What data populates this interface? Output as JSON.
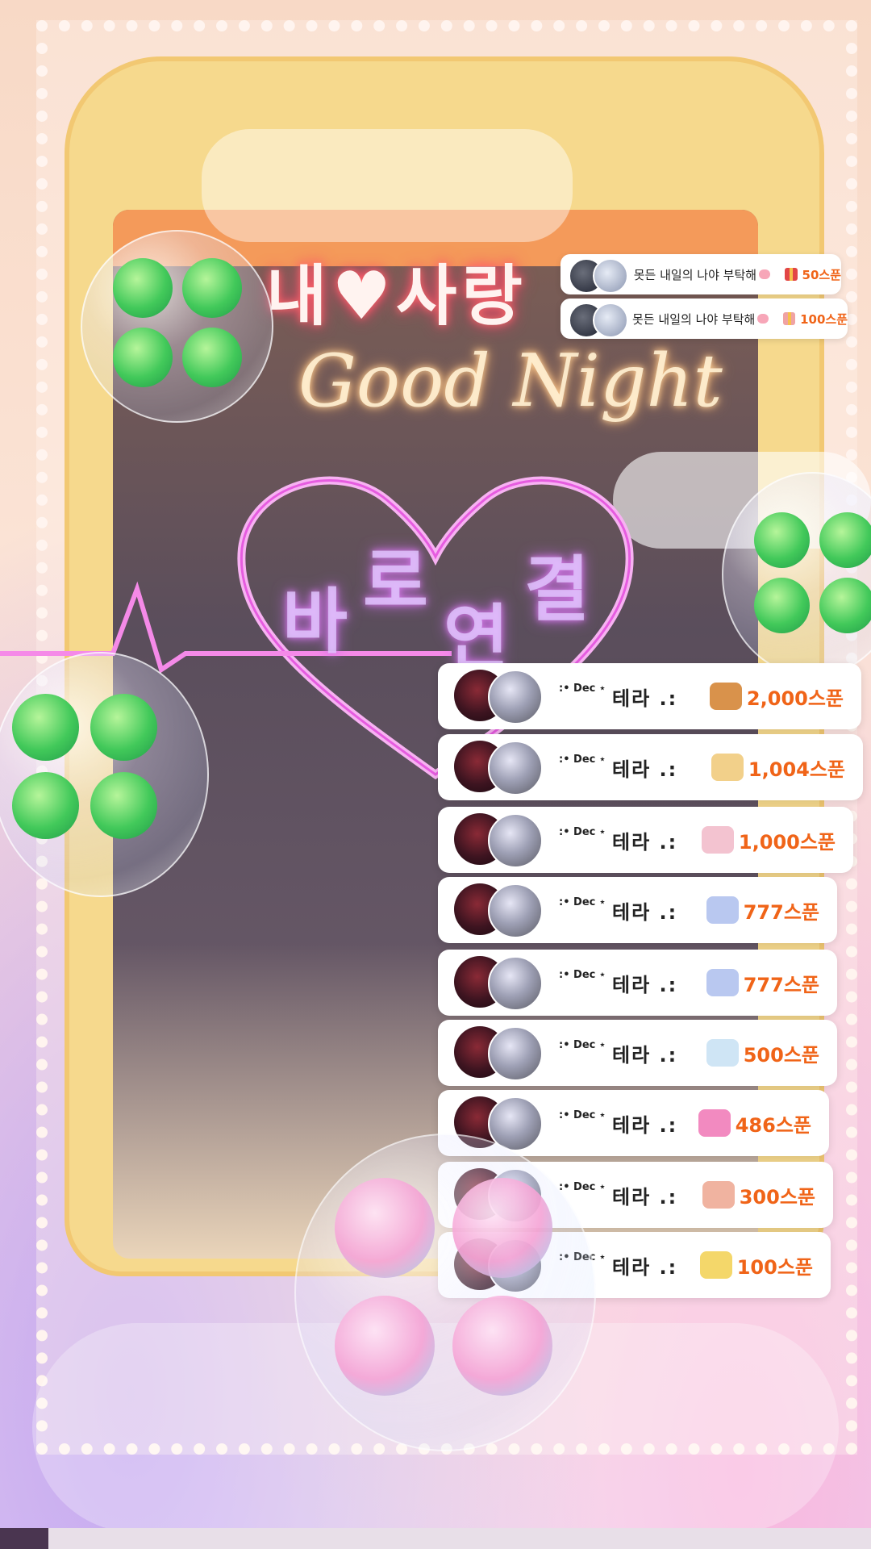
{
  "overlay": {
    "title_line1": "내♥사랑",
    "title_script": "Good Night",
    "center_text": [
      "바",
      "로",
      "연",
      "결"
    ]
  },
  "toasts": [
    {
      "message": "못든 내일의 나야 부탁해",
      "amount": "50스푼"
    },
    {
      "message": "못든 내일의 나야 부탁해",
      "amount": "100스푼"
    }
  ],
  "donation_list": [
    {
      "user_prefix": ":• Dec ⋆",
      "user_name": "테라 .:",
      "amount": "2,000스푼",
      "icon": "bread-gift-icon",
      "icon_color": "#d9924b"
    },
    {
      "user_prefix": ":• Dec ⋆",
      "user_name": "테라 .:",
      "amount": "1,004스푼",
      "icon": "angel-hands-gift-icon",
      "icon_color": "#f2d08a"
    },
    {
      "user_prefix": ":• Dec ⋆",
      "user_name": "테라 .:",
      "amount": "1,000스푼",
      "icon": "flower-card-gift-icon",
      "icon_color": "#f3c3d0"
    },
    {
      "user_prefix": ":• Dec ⋆",
      "user_name": "테라 .:",
      "amount": "777스푼",
      "icon": "rainbow-gift-icon",
      "icon_color": "#b9c8f0"
    },
    {
      "user_prefix": ":• Dec ⋆",
      "user_name": "테라 .:",
      "amount": "777스푼",
      "icon": "rainbow-gift-icon",
      "icon_color": "#b9c8f0"
    },
    {
      "user_prefix": ":• Dec ⋆",
      "user_name": "테라 .:",
      "amount": "500스푼",
      "icon": "envelope-gift-icon",
      "icon_color": "#cfe5f5"
    },
    {
      "user_prefix": ":• Dec ⋆",
      "user_name": "테라 .:",
      "amount": "486스푼",
      "icon": "heart-gift-icon",
      "icon_color": "#f28ac0"
    },
    {
      "user_prefix": ":• Dec ⋆",
      "user_name": "테라 .:",
      "amount": "300스푼",
      "icon": "fan-gift-icon",
      "icon_color": "#f0b3a0"
    },
    {
      "user_prefix": ":• Dec ⋆",
      "user_name": "테라 .:",
      "amount": "100스푼",
      "icon": "sparkle-gift-icon",
      "icon_color": "#f4d76a"
    }
  ]
}
